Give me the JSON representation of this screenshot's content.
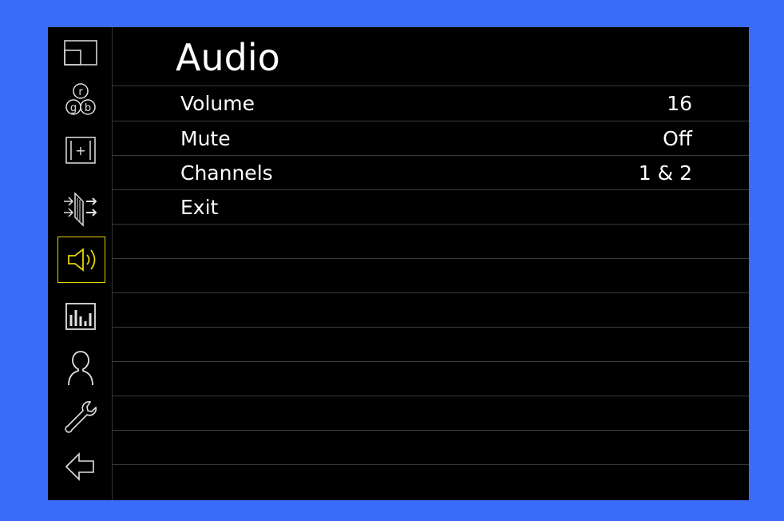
{
  "osd": {
    "title": "Audio",
    "menu_items": [
      {
        "label": "Volume",
        "value": "16"
      },
      {
        "label": "Mute",
        "value": "Off"
      },
      {
        "label": "Channels",
        "value": "1 & 2"
      },
      {
        "label": "Exit",
        "value": ""
      }
    ],
    "sidebar": [
      {
        "icon": "window-layout-icon",
        "active": false
      },
      {
        "icon": "rgb-color-icon",
        "active": false,
        "glyphs": [
          "r",
          "g",
          "b"
        ]
      },
      {
        "icon": "marker-plus-icon",
        "active": false,
        "glyph": "+"
      },
      {
        "icon": "input-arrows-icon",
        "active": false
      },
      {
        "icon": "speaker-icon",
        "active": true
      },
      {
        "icon": "audio-meter-icon",
        "active": false
      },
      {
        "icon": "user-icon",
        "active": false
      },
      {
        "icon": "wrench-icon",
        "active": false
      },
      {
        "icon": "back-arrow-icon",
        "active": false
      }
    ],
    "colors": {
      "background": "#3b6cf8",
      "panel": "#000000",
      "text": "#ffffff",
      "icon": "#e0e0e0",
      "active": "#e6d200"
    }
  }
}
